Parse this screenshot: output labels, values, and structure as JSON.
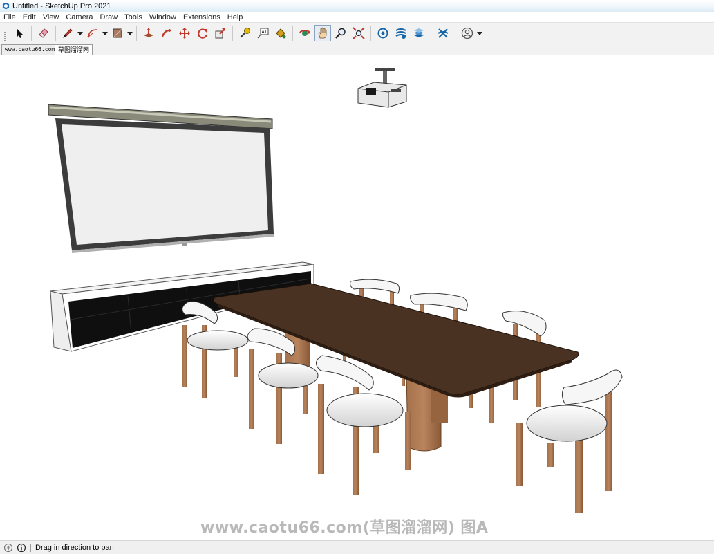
{
  "window": {
    "title": "Untitled - SketchUp Pro 2021"
  },
  "menu": [
    "File",
    "Edit",
    "View",
    "Camera",
    "Draw",
    "Tools",
    "Window",
    "Extensions",
    "Help"
  ],
  "toolbar": {
    "tools": [
      {
        "icon": "select-arrow-icon"
      },
      {
        "icon": "eraser-icon"
      },
      {
        "icon": "pencil-line-icon"
      },
      {
        "icon": "arc-icon"
      },
      {
        "icon": "rectangle-shape-icon"
      },
      {
        "icon": "push-pull-icon"
      },
      {
        "icon": "follow-me-icon"
      },
      {
        "icon": "move-icon"
      },
      {
        "icon": "rotate-icon"
      },
      {
        "icon": "scale-icon"
      },
      {
        "icon": "tape-measure-icon"
      },
      {
        "icon": "text-label-icon"
      },
      {
        "icon": "paint-bucket-icon"
      },
      {
        "icon": "orbit-icon"
      },
      {
        "icon": "pan-hand-icon",
        "active": true
      },
      {
        "icon": "zoom-icon"
      },
      {
        "icon": "zoom-extents-icon"
      },
      {
        "icon": "3d-warehouse-icon"
      },
      {
        "icon": "extension-warehouse-icon"
      },
      {
        "icon": "layout-icon"
      },
      {
        "icon": "extension-manager-icon"
      },
      {
        "icon": "account-icon"
      }
    ]
  },
  "tabs": [
    {
      "label": "www.caotu66.com"
    },
    {
      "label": "草图溜溜网",
      "selected": true
    }
  ],
  "scene": {
    "watermark": "www.caotu66.com(草图溜溜网) 图A",
    "table_color": "#4a3222",
    "chair_leg_color": "#a5714b",
    "cabinet_front_color": "#0f0f0f"
  },
  "status": {
    "text": "Drag in direction to pan"
  }
}
